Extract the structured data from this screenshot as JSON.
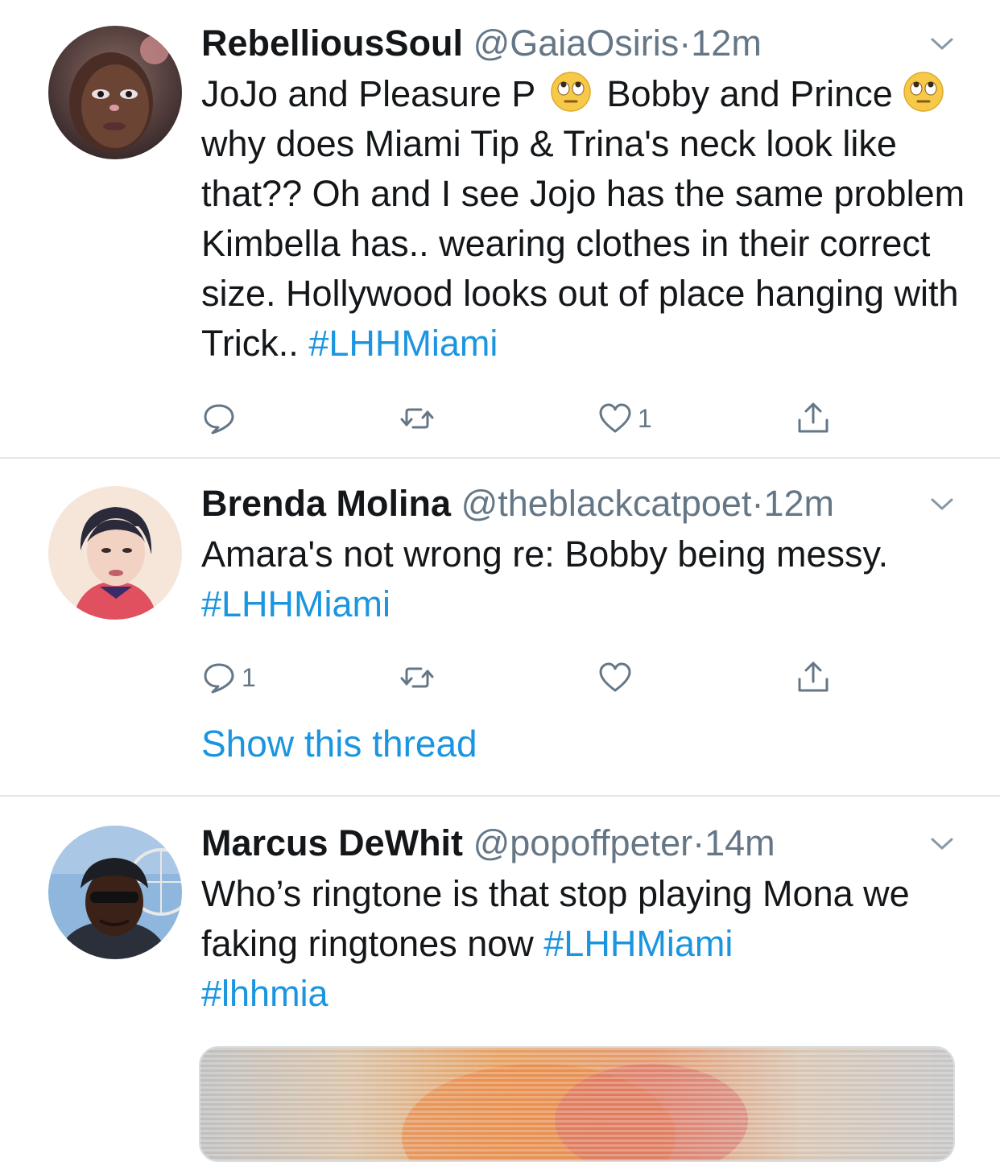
{
  "tweets": [
    {
      "name": "RebelliousSoul",
      "handle": "@GaiaOsiris",
      "dot": "·",
      "time": "12m",
      "text_parts": {
        "t1": "JoJo and Pleasure P",
        "t2": "Bobby and Prince",
        "t3": "why does Miami Tip & Trina's neck look like that?? Oh and I see Jojo has the same problem Kimbella has.. wearing clothes in their correct size. Hollywood looks out of place hanging with Trick..",
        "hashtag": "#LHHMiami"
      },
      "emoji": "face-with-rolling-eyes",
      "actions": {
        "reply_count": "",
        "retweet_count": "",
        "like_count": "1"
      }
    },
    {
      "name": "Brenda Molina",
      "handle": "@theblackcatpoet",
      "dot": "·",
      "time": "12m",
      "text_parts": {
        "t1": "Amara's not wrong re: Bobby being messy.",
        "hashtag": "#LHHMiami"
      },
      "actions": {
        "reply_count": "1",
        "retweet_count": "",
        "like_count": ""
      },
      "show_thread": "Show this thread"
    },
    {
      "name": "Marcus DeWhit",
      "handle": "@popoffpeter",
      "dot": "·",
      "time": "14m",
      "text_parts": {
        "t1": "Who’s ringtone is that stop playing Mona we faking ringtones now",
        "hashtag": "#LHHMiami",
        "hashtag2": "#lhhmia"
      }
    }
  ],
  "colors": {
    "link": "#1b95e0",
    "secondary": "#657786",
    "divider": "#e1e8ed"
  },
  "icons": [
    "reply-icon",
    "retweet-icon",
    "like-icon",
    "share-icon",
    "chevron-down-icon",
    "emoji-rolling-eyes-icon"
  ]
}
